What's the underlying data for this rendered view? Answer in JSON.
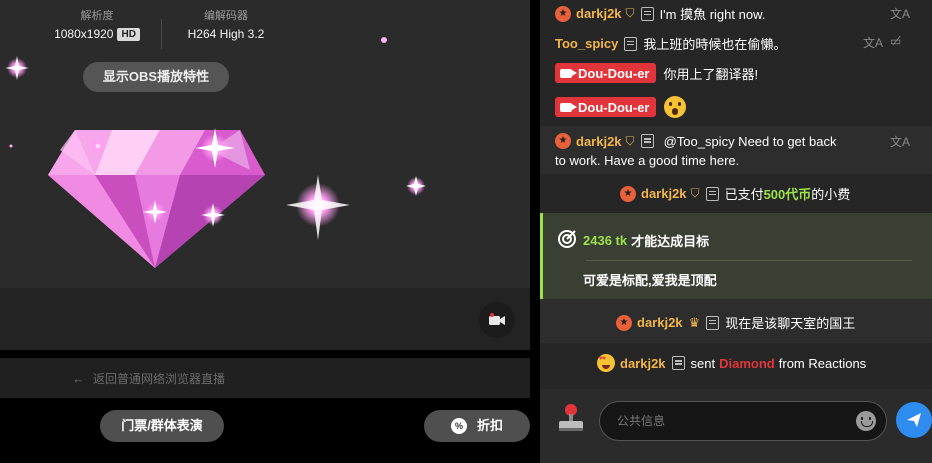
{
  "stream": {
    "resolution_label": "解析度",
    "resolution_value": "1080x1920",
    "hd_badge": "HD",
    "codec_label": "编解码器",
    "codec_value": "H264 High 3.2",
    "obs_button": "显示OBS播放特性",
    "back_link": "返回普通网络浏览器直播",
    "ticket_button": "门票/群体表演",
    "discount_button": "折扣",
    "discount_icon": "%"
  },
  "chat": {
    "messages": [
      {
        "user": "darkj2k",
        "text": "I'm 摸魚 right now."
      },
      {
        "user": "Too_spicy",
        "text": "我上班的時候也在偷懶。"
      },
      {
        "user": "Dou-Dou-er",
        "text": "你用上了翻译器!"
      },
      {
        "user": "Dou-Dou-er",
        "text": ""
      },
      {
        "user": "darkj2k",
        "text": "@Too_spicy  Need to get back",
        "text2": "to work. Have a good time here."
      }
    ],
    "tip": {
      "user": "darkj2k",
      "pre": "已支付",
      "amount": "500代币",
      "post": "的小费"
    },
    "goal": {
      "amount": "2436 tk",
      "suffix": "才能达成目标",
      "line": "可爱是标配,爱我是顶配"
    },
    "king": {
      "user": "darkj2k",
      "text": "现在是该聊天室的国王"
    },
    "sent": {
      "user": "darkj2k",
      "pre": "sent",
      "gift": "Diamond",
      "post": "from Reactions"
    },
    "input_placeholder": "公共信息"
  },
  "colors": {
    "accent_green": "#9be34a",
    "username_gold": "#f2b64a",
    "badge_red": "#e2353b",
    "send_blue": "#2f8cf0"
  }
}
